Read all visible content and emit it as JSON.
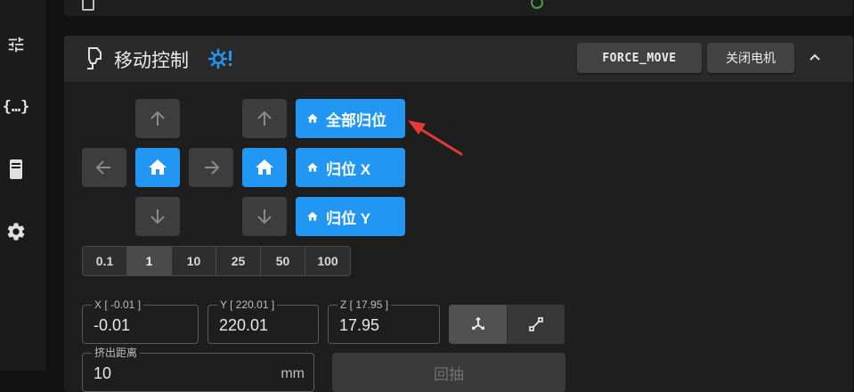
{
  "sidebar": {
    "items": [
      {
        "icon": "tune-icon"
      },
      {
        "icon": "code-braces-icon"
      },
      {
        "icon": "printer-icon"
      },
      {
        "icon": "gear-icon"
      }
    ]
  },
  "card": {
    "title": "移动控制",
    "buttons": {
      "force_move": "FORCE_MOVE",
      "motors_off": "关闭电机"
    }
  },
  "home": {
    "all": "全部归位",
    "x": "归位 X",
    "y": "归位 Y"
  },
  "step_sizes": [
    "0.1",
    "1",
    "10",
    "25",
    "50",
    "100"
  ],
  "selected_step": "1",
  "position": {
    "x": {
      "label": "X [ -0.01 ]",
      "value": "-0.01"
    },
    "y": {
      "label": "Y [ 220.01 ]",
      "value": "220.01"
    },
    "z": {
      "label": "Z [ 17.95 ]",
      "value": "17.95"
    }
  },
  "extrude": {
    "label": "挤出距离",
    "value": "10",
    "unit": "mm",
    "button": "回抽"
  },
  "colors": {
    "accent": "#2196f3",
    "annotation_arrow": "#e53935",
    "status_ok": "#43a047"
  }
}
